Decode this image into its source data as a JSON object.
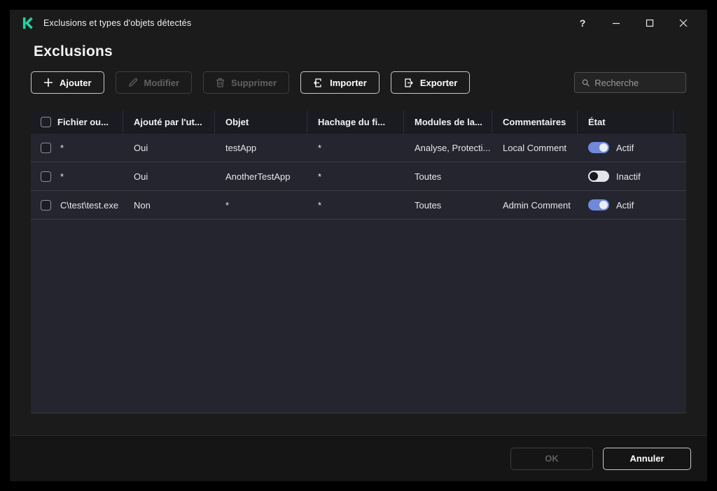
{
  "window": {
    "title": "Exclusions et types d'objets détectés",
    "controls": {
      "help": "?"
    }
  },
  "page": {
    "heading": "Exclusions"
  },
  "toolbar": {
    "add_label": "Ajouter",
    "edit_label": "Modifier",
    "delete_label": "Supprimer",
    "import_label": "Importer",
    "export_label": "Exporter",
    "search_placeholder": "Recherche",
    "search_value": ""
  },
  "table": {
    "columns": [
      "Fichier ou...",
      "Ajouté par l'ut...",
      "Objet",
      "Hachage du fi...",
      "Modules de la...",
      "Commentaires",
      "État"
    ],
    "rows": [
      {
        "file": "*",
        "added_by_user": "Oui",
        "object": "testApp",
        "hash": "*",
        "modules": "Analyse, Protecti...",
        "comment": "Local Comment",
        "state": "Actif",
        "enabled": true
      },
      {
        "file": "*",
        "added_by_user": "Oui",
        "object": "AnotherTestApp",
        "hash": "*",
        "modules": "Toutes",
        "comment": "",
        "state": "Inactif",
        "enabled": false
      },
      {
        "file": "C\\test\\test.exe",
        "added_by_user": "Non",
        "object": "*",
        "hash": "*",
        "modules": "Toutes",
        "comment": "Admin Comment",
        "state": "Actif",
        "enabled": true
      }
    ]
  },
  "footer": {
    "ok_label": "OK",
    "cancel_label": "Annuler"
  },
  "colors": {
    "brand_teal": "#23d1a0",
    "toggle_on": "#7189da",
    "row_bg": "#25252f",
    "header_bg": "#1a1a21",
    "window_bg": "#1b1b1b"
  }
}
